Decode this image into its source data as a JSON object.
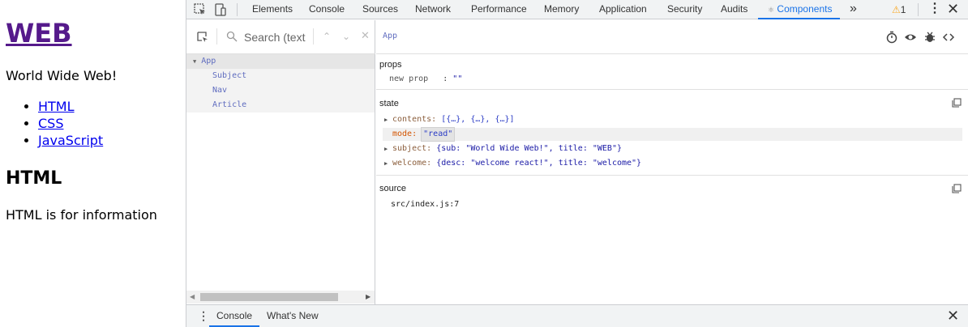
{
  "page": {
    "title": "WEB",
    "intro": "World Wide Web!",
    "links": [
      "HTML",
      "CSS",
      "JavaScript"
    ],
    "heading": "HTML",
    "description": "HTML is for information"
  },
  "devtools": {
    "tabs": [
      "Elements",
      "Console",
      "Sources",
      "Network",
      "Performance",
      "Memory",
      "Application",
      "Security",
      "Audits",
      "Components"
    ],
    "active_tab": "Components",
    "warning_count": "1",
    "search_placeholder": "Search (text",
    "tree": [
      {
        "label": "App",
        "expanded": true
      },
      {
        "label": "Subject"
      },
      {
        "label": "Nav"
      },
      {
        "label": "Article"
      }
    ],
    "selected_component": "App",
    "props": {
      "title": "props",
      "rows": [
        {
          "key": "new prop",
          "sep": ":",
          "value": "\"\""
        }
      ]
    },
    "state": {
      "title": "state",
      "contents_key": "contents:",
      "contents_val": "[{…}, {…}, {…}]",
      "mode_key": "mode:",
      "mode_val": "\"read\"",
      "subject_key": "subject:",
      "subject_val": "{sub: \"World Wide Web!\", title: \"WEB\"}",
      "welcome_key": "welcome:",
      "welcome_val": "{desc: \"welcome react!\", title: \"welcome\"}"
    },
    "source": {
      "title": "source",
      "file": "src/index.js:7"
    },
    "drawer_tabs": [
      "Console",
      "What's New"
    ]
  }
}
